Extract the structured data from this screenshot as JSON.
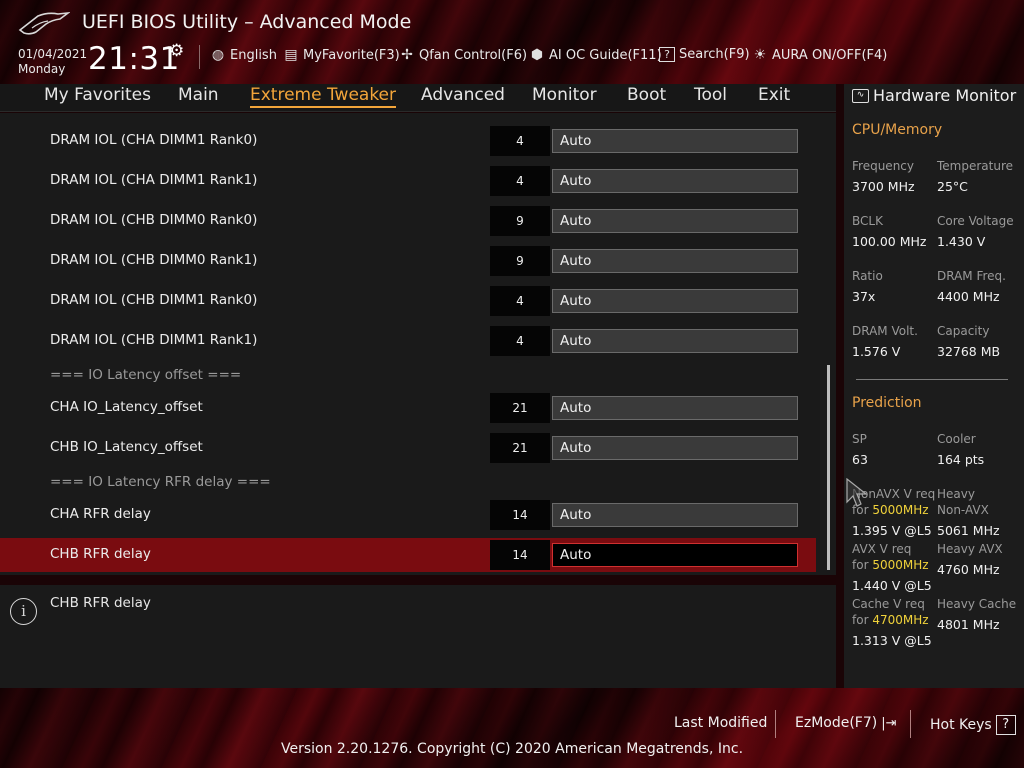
{
  "window": {
    "title": "UEFI BIOS Utility – Advanced Mode"
  },
  "clock": {
    "date": "01/04/2021",
    "day": "Monday",
    "time": "21:31"
  },
  "toolbar": [
    {
      "icon": "globe-icon",
      "glyph": "🌐",
      "label": "English"
    },
    {
      "icon": "favorite-icon",
      "glyph": "▤",
      "label": "MyFavorite(F3)"
    },
    {
      "icon": "fan-icon",
      "glyph": "✢",
      "label": "Qfan Control(F6)"
    },
    {
      "icon": "ai-chip-icon",
      "glyph": "⬢",
      "label": "AI OC Guide(F11)"
    },
    {
      "icon": "search-help-icon",
      "glyph": "?",
      "label": "Search(F9)"
    },
    {
      "icon": "aura-icon",
      "glyph": "☀",
      "label": "AURA ON/OFF(F4)"
    }
  ],
  "tabs": [
    {
      "id": "my-favorites",
      "label": "My Favorites"
    },
    {
      "id": "main",
      "label": "Main"
    },
    {
      "id": "extreme-tweaker",
      "label": "Extreme Tweaker",
      "active": true
    },
    {
      "id": "advanced",
      "label": "Advanced"
    },
    {
      "id": "monitor",
      "label": "Monitor"
    },
    {
      "id": "boot",
      "label": "Boot"
    },
    {
      "id": "tool",
      "label": "Tool"
    },
    {
      "id": "exit",
      "label": "Exit"
    }
  ],
  "settings": [
    {
      "label": "DRAM IOL (CHA DIMM1 Rank0)",
      "value": "4",
      "option": "Auto"
    },
    {
      "label": "DRAM IOL (CHA DIMM1 Rank1)",
      "value": "4",
      "option": "Auto"
    },
    {
      "label": "DRAM IOL (CHB DIMM0 Rank0)",
      "value": "9",
      "option": "Auto"
    },
    {
      "label": "DRAM IOL (CHB DIMM0 Rank1)",
      "value": "9",
      "option": "Auto"
    },
    {
      "label": "DRAM IOL (CHB DIMM1 Rank0)",
      "value": "4",
      "option": "Auto"
    },
    {
      "label": "DRAM IOL (CHB DIMM1 Rank1)",
      "value": "4",
      "option": "Auto"
    },
    {
      "section": "=== IO Latency offset ==="
    },
    {
      "label": "CHA IO_Latency_offset",
      "value": "21",
      "option": "Auto"
    },
    {
      "label": "CHB IO_Latency_offset",
      "value": "21",
      "option": "Auto"
    },
    {
      "section": "=== IO Latency RFR delay ==="
    },
    {
      "label": "CHA RFR delay",
      "value": "14",
      "option": "Auto"
    },
    {
      "label": "CHB RFR delay",
      "value": "14",
      "option": "Auto",
      "selected": true
    }
  ],
  "info": {
    "text": "CHB RFR delay"
  },
  "hardware_monitor": {
    "title": "Hardware Monitor",
    "cpu_memory": {
      "heading": "CPU/Memory",
      "frequency_label": "Frequency",
      "frequency": "3700 MHz",
      "temperature_label": "Temperature",
      "temperature": "25°C",
      "bclk_label": "BCLK",
      "bclk": "100.00 MHz",
      "core_voltage_label": "Core Voltage",
      "core_voltage": "1.430 V",
      "ratio_label": "Ratio",
      "ratio": "37x",
      "dram_freq_label": "DRAM Freq.",
      "dram_freq": "4400 MHz",
      "dram_volt_label": "DRAM Volt.",
      "dram_volt": "1.576 V",
      "capacity_label": "Capacity",
      "capacity": "32768 MB"
    },
    "prediction": {
      "heading": "Prediction",
      "sp_label": "SP",
      "sp": "63",
      "cooler_label": "Cooler",
      "cooler": "164 pts",
      "nonavx_label_1": "NonAVX V req",
      "for_word": "for",
      "nonavx_freq": "5000MHz",
      "nonavx_v": "1.395 V @L5",
      "heavy_nonavx_label_1": "Heavy",
      "heavy_nonavx_label_2": "Non-AVX",
      "heavy_nonavx": "5061 MHz",
      "avx_label_1": "AVX V req",
      "avx_freq": "5000MHz",
      "avx_v": "1.440 V @L5",
      "heavy_avx_label": "Heavy AVX",
      "heavy_avx": "4760 MHz",
      "cache_label_1": "Cache V req",
      "cache_freq": "4700MHz",
      "cache_v": "1.313 V @L5",
      "heavy_cache_label": "Heavy Cache",
      "heavy_cache": "4801 MHz"
    }
  },
  "footer": {
    "last_modified": "Last Modified",
    "ezmode": "EzMode(F7)",
    "hotkeys": "Hot Keys",
    "version": "Version 2.20.1276. Copyright (C) 2020 American Megatrends, Inc."
  },
  "colors": {
    "accent": "#f3a53a",
    "selected_row": "#7a0c10",
    "highlight_freq": "#f0d23a"
  }
}
